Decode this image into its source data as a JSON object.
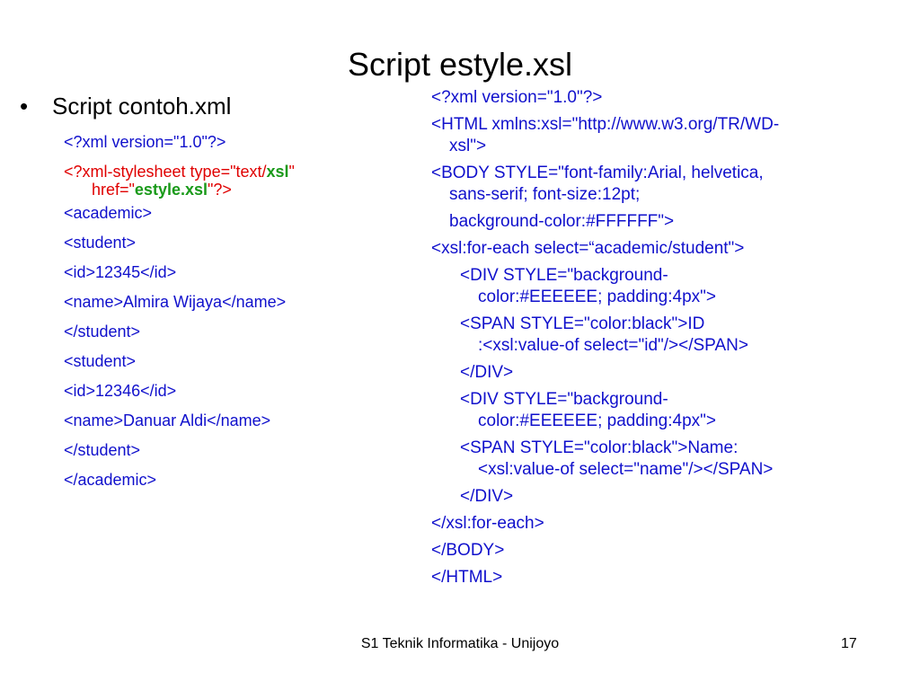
{
  "slide": {
    "title": "Script estyle.xsl",
    "left_heading": "Script contoh.xml",
    "bullet": "•",
    "xml_lines": [
      "<?xml version=\"1.0\"?>",
      "<academic>",
      "<student>",
      "<id>12345</id>",
      "<name>Almira Wijaya</name>",
      "</student>",
      "<student>",
      "<id>12346</id>",
      "<name>Danuar Aldi</name>",
      "</student>",
      "</academic>"
    ],
    "stylesheet_line": {
      "part1": "<?xml-stylesheet type=\"text/",
      "xsl": "xsl",
      "part2": "\"",
      "part3": "href=\"",
      "estyle": "estyle.xsl",
      "part4": "\"?>"
    },
    "xsl_lines": [
      "<?xml version=\"1.0\"?>",
      "<HTML xmlns:xsl=\"http://www.w3.org/TR/WD-",
      "xsl\">",
      "<BODY STYLE=\"font-family:Arial, helvetica,",
      "sans-serif; font-size:12pt;",
      "background-color:#FFFFFF\">",
      "<xsl:for-each select=“academic/student\">",
      "<DIV STYLE=\"background-",
      "color:#EEEEEE; padding:4px\">",
      "<SPAN STYLE=\"color:black\">ID",
      ":<xsl:value-of select=\"id\"/></SPAN>",
      "</DIV>",
      "<DIV STYLE=\"background-",
      "color:#EEEEEE; padding:4px\">",
      "<SPAN STYLE=\"color:black\">Name:",
      "<xsl:value-of select=\"name\"/></SPAN>",
      "</DIV>",
      "</xsl:for-each>",
      "</BODY>",
      "</HTML>"
    ],
    "footer": "S1 Teknik Informatika - Unijoyo",
    "page_number": "17",
    "colors": {
      "code_blue": "#1010cc",
      "stylesheet_red": "#e00000",
      "xsl_green": "#1a9a1a"
    }
  }
}
